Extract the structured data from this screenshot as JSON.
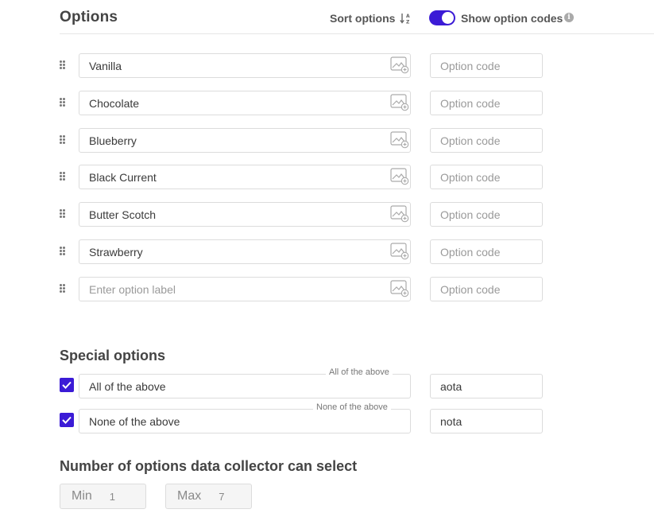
{
  "header": {
    "title": "Options",
    "sort_label": "Sort options",
    "show_codes_label": "Show option codes",
    "show_codes_enabled": true
  },
  "options": [
    {
      "label": "Vanilla",
      "code_placeholder": "Option code"
    },
    {
      "label": "Chocolate",
      "code_placeholder": "Option code"
    },
    {
      "label": "Blueberry",
      "code_placeholder": "Option code"
    },
    {
      "label": "Black Current",
      "code_placeholder": "Option code"
    },
    {
      "label": "Butter Scotch",
      "code_placeholder": "Option code"
    },
    {
      "label": "Strawberry",
      "code_placeholder": "Option code"
    }
  ],
  "new_option": {
    "label_placeholder": "Enter option label",
    "code_placeholder": "Option code"
  },
  "special": {
    "title": "Special options",
    "items": [
      {
        "label": "All of the above",
        "tag": "All of the above",
        "code": "aota",
        "checked": true
      },
      {
        "label": "None of the above",
        "tag": "None of the above",
        "code": "nota",
        "checked": true
      }
    ]
  },
  "selection": {
    "title": "Number of options data collector can select",
    "min_label": "Min",
    "min_value": "1",
    "max_label": "Max",
    "max_value": "7"
  },
  "colors": {
    "accent": "#3b1bd6"
  }
}
